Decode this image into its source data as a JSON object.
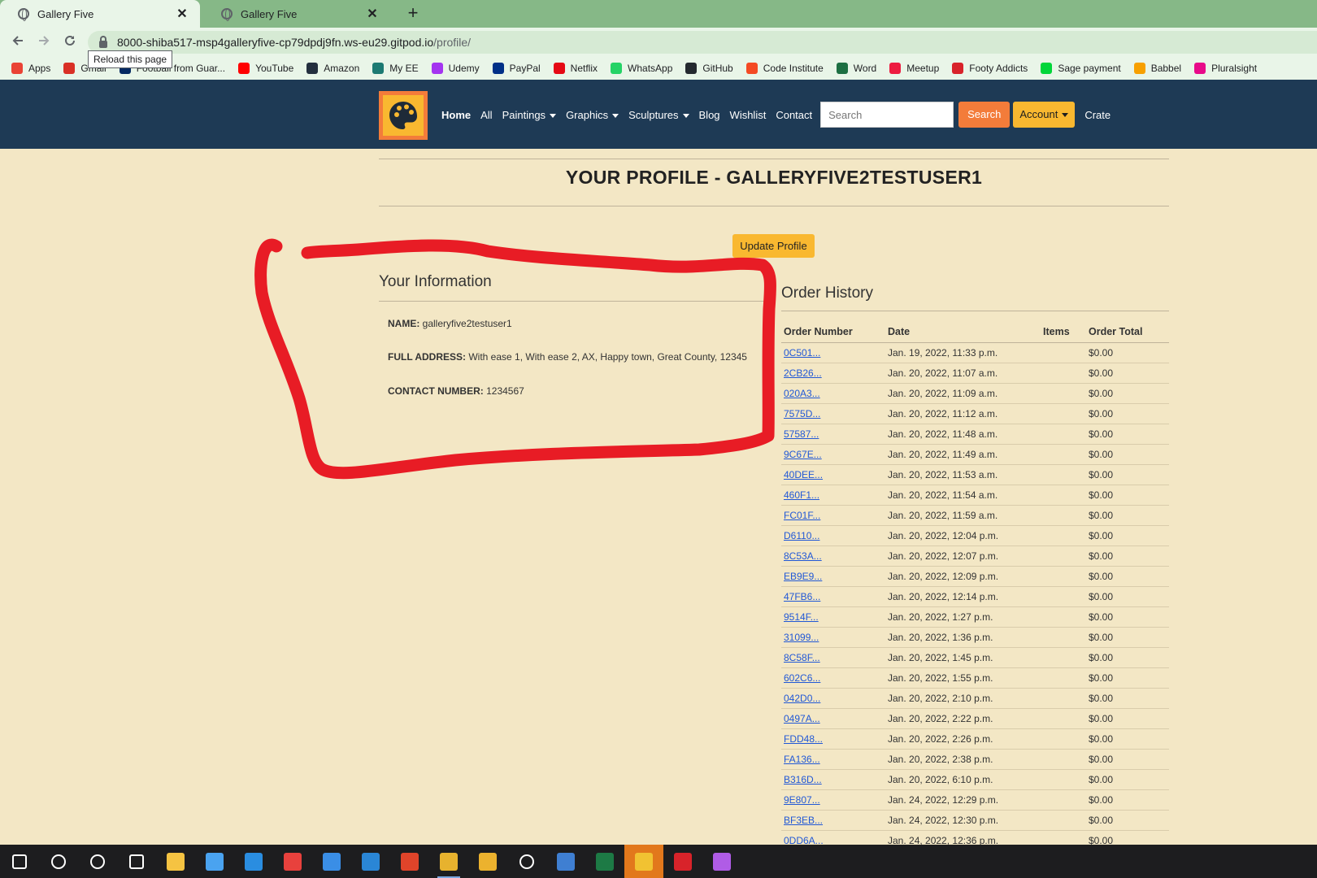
{
  "browser": {
    "tabs": [
      {
        "title": "Gallery Five",
        "active": true
      },
      {
        "title": "Gallery Five",
        "active": false
      }
    ],
    "close_glyph": "✕",
    "new_tab_glyph": "+",
    "url_host": "8000-shiba517-msp4galleryfive-cp79dpdj9fn.ws-eu29.gitpod.io",
    "url_path": "/profile/",
    "tooltip": "Reload this page",
    "bookmarks": [
      {
        "label": "Apps",
        "icon": "apps-grid-icon",
        "color": "#ea4335"
      },
      {
        "label": "Gmail",
        "icon": "gmail-icon",
        "color": "#d93025"
      },
      {
        "label": "Football from Guar...",
        "icon": "guardian-icon",
        "color": "#052962"
      },
      {
        "label": "YouTube",
        "icon": "youtube-icon",
        "color": "#ff0000"
      },
      {
        "label": "Amazon",
        "icon": "amazon-icon",
        "color": "#232f3e"
      },
      {
        "label": "My EE",
        "icon": "ee-icon",
        "color": "#1c7a72"
      },
      {
        "label": "Udemy",
        "icon": "udemy-icon",
        "color": "#a435f0"
      },
      {
        "label": "PayPal",
        "icon": "paypal-icon",
        "color": "#003087"
      },
      {
        "label": "Netflix",
        "icon": "netflix-icon",
        "color": "#e50914"
      },
      {
        "label": "WhatsApp",
        "icon": "whatsapp-icon",
        "color": "#25d366"
      },
      {
        "label": "GitHub",
        "icon": "github-icon",
        "color": "#24292f"
      },
      {
        "label": "Code Institute",
        "icon": "code-institute-icon",
        "color": "#f44a23"
      },
      {
        "label": "Word",
        "icon": "excel-word-icon",
        "color": "#1d6f42"
      },
      {
        "label": "Meetup",
        "icon": "meetup-icon",
        "color": "#ed1c40"
      },
      {
        "label": "Footy Addicts",
        "icon": "footy-addicts-icon",
        "color": "#d8232a"
      },
      {
        "label": "Sage payment",
        "icon": "sage-icon",
        "color": "#00d639"
      },
      {
        "label": "Babbel",
        "icon": "babbel-icon",
        "color": "#f7a000"
      },
      {
        "label": "Pluralsight",
        "icon": "pluralsight-icon",
        "color": "#e80a89"
      }
    ]
  },
  "site": {
    "colors": {
      "header": "#1e3a55",
      "accent_orange": "#f37c3a",
      "accent_yellow": "#f9b830",
      "background": "#f3e7c5"
    },
    "logo_icon": "palette-icon",
    "nav": {
      "home": "Home",
      "all": "All",
      "paintings": "Paintings",
      "graphics": "Graphics",
      "sculptures": "Sculptures",
      "blog": "Blog",
      "wishlist": "Wishlist",
      "contact": "Contact",
      "search_placeholder": "Search",
      "search_button": "Search",
      "account": "Account",
      "crate": "Crate"
    }
  },
  "profile": {
    "title_prefix": "YOUR PROFILE - ",
    "username": "GALLERYFIVE2TESTUSER1",
    "update_button": "Update Profile",
    "info_title": "Your Information",
    "name_label": "NAME:",
    "name_value": "galleryfive2testuser1",
    "address_label": "FULL ADDRESS:",
    "address_value": "With ease 1, With ease 2, AX, Happy town, Great County, 12345",
    "contact_label": "CONTACT NUMBER:",
    "contact_value": "1234567"
  },
  "orders": {
    "title": "Order History",
    "columns": [
      "Order Number",
      "Date",
      "Items",
      "Order Total"
    ],
    "rows": [
      {
        "number": "0C501...",
        "date": "Jan. 19, 2022, 11:33 p.m.",
        "items": "",
        "total": "$0.00"
      },
      {
        "number": "2CB26...",
        "date": "Jan. 20, 2022, 11:07 a.m.",
        "items": "",
        "total": "$0.00"
      },
      {
        "number": "020A3...",
        "date": "Jan. 20, 2022, 11:09 a.m.",
        "items": "",
        "total": "$0.00"
      },
      {
        "number": "7575D...",
        "date": "Jan. 20, 2022, 11:12 a.m.",
        "items": "",
        "total": "$0.00"
      },
      {
        "number": "57587...",
        "date": "Jan. 20, 2022, 11:48 a.m.",
        "items": "",
        "total": "$0.00"
      },
      {
        "number": "9C67E...",
        "date": "Jan. 20, 2022, 11:49 a.m.",
        "items": "",
        "total": "$0.00"
      },
      {
        "number": "40DEE...",
        "date": "Jan. 20, 2022, 11:53 a.m.",
        "items": "",
        "total": "$0.00"
      },
      {
        "number": "460F1...",
        "date": "Jan. 20, 2022, 11:54 a.m.",
        "items": "",
        "total": "$0.00"
      },
      {
        "number": "FC01F...",
        "date": "Jan. 20, 2022, 11:59 a.m.",
        "items": "",
        "total": "$0.00"
      },
      {
        "number": "D6110...",
        "date": "Jan. 20, 2022, 12:04 p.m.",
        "items": "",
        "total": "$0.00"
      },
      {
        "number": "8C53A...",
        "date": "Jan. 20, 2022, 12:07 p.m.",
        "items": "",
        "total": "$0.00"
      },
      {
        "number": "EB9E9...",
        "date": "Jan. 20, 2022, 12:09 p.m.",
        "items": "",
        "total": "$0.00"
      },
      {
        "number": "47FB6...",
        "date": "Jan. 20, 2022, 12:14 p.m.",
        "items": "",
        "total": "$0.00"
      },
      {
        "number": "9514F...",
        "date": "Jan. 20, 2022, 1:27 p.m.",
        "items": "",
        "total": "$0.00"
      },
      {
        "number": "31099...",
        "date": "Jan. 20, 2022, 1:36 p.m.",
        "items": "",
        "total": "$0.00"
      },
      {
        "number": "8C58F...",
        "date": "Jan. 20, 2022, 1:45 p.m.",
        "items": "",
        "total": "$0.00"
      },
      {
        "number": "602C6...",
        "date": "Jan. 20, 2022, 1:55 p.m.",
        "items": "",
        "total": "$0.00"
      },
      {
        "number": "042D0...",
        "date": "Jan. 20, 2022, 2:10 p.m.",
        "items": "",
        "total": "$0.00"
      },
      {
        "number": "0497A...",
        "date": "Jan. 20, 2022, 2:22 p.m.",
        "items": "",
        "total": "$0.00"
      },
      {
        "number": "FDD48...",
        "date": "Jan. 20, 2022, 2:26 p.m.",
        "items": "",
        "total": "$0.00"
      },
      {
        "number": "FA136...",
        "date": "Jan. 20, 2022, 2:38 p.m.",
        "items": "",
        "total": "$0.00"
      },
      {
        "number": "B316D...",
        "date": "Jan. 20, 2022, 6:10 p.m.",
        "items": "",
        "total": "$0.00"
      },
      {
        "number": "9E807...",
        "date": "Jan. 24, 2022, 12:29 p.m.",
        "items": "",
        "total": "$0.00"
      },
      {
        "number": "BF3EB...",
        "date": "Jan. 24, 2022, 12:30 p.m.",
        "items": "",
        "total": "$0.00"
      },
      {
        "number": "0DD6A...",
        "date": "Jan. 24, 2022, 12:36 p.m.",
        "items": "",
        "total": "$0.00"
      }
    ]
  },
  "taskbar": {
    "items": [
      {
        "icon": "windows-start-icon",
        "color": "#ffffff"
      },
      {
        "icon": "search-icon",
        "color": "#ffffff"
      },
      {
        "icon": "cortana-icon",
        "color": "#ffffff"
      },
      {
        "icon": "task-view-icon",
        "color": "#ffffff"
      },
      {
        "icon": "file-explorer-icon",
        "color": "#f5c342"
      },
      {
        "icon": "microsoft-store-icon",
        "color": "#4aa3f0"
      },
      {
        "icon": "edge-icon",
        "color": "#2a8de0"
      },
      {
        "icon": "gift-icon",
        "color": "#e8413d"
      },
      {
        "icon": "mail-icon",
        "color": "#3a8ee6"
      },
      {
        "icon": "vscode-icon",
        "color": "#2a86d6"
      },
      {
        "icon": "office-icon",
        "color": "#e0442a"
      },
      {
        "icon": "chrome-icon",
        "color": "#e7b22e"
      },
      {
        "icon": "slack-icon",
        "color": "#ecb22e"
      },
      {
        "icon": "emoji-icon",
        "color": "#ffffff"
      },
      {
        "icon": "photos-icon",
        "color": "#3f7fd2"
      },
      {
        "icon": "excel-icon",
        "color": "#1d7a45"
      },
      {
        "icon": "security-shield-icon",
        "color": "#f1c232"
      },
      {
        "icon": "mcafee-icon",
        "color": "#d8232a"
      },
      {
        "icon": "paint-drop-icon",
        "color": "#b05ce6"
      }
    ]
  }
}
